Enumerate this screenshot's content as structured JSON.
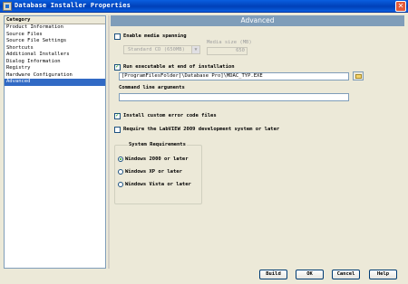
{
  "window": {
    "title": "Database Installer Properties",
    "close_glyph": "✕"
  },
  "category": {
    "header": "Category",
    "items": [
      "Product Information",
      "Source Files",
      "Source File Settings",
      "Shortcuts",
      "Additional Installers",
      "Dialog Information",
      "Registry",
      "Hardware Configuration",
      "Advanced"
    ],
    "selected": "Advanced"
  },
  "advanced": {
    "banner": "Advanced",
    "media_spanning": {
      "label": "Enable media spanning",
      "checked": false
    },
    "media_combo": {
      "value": "Standard CD (650MB)"
    },
    "media_size": {
      "label": "Media size (MB)",
      "value": "650"
    },
    "run_exe": {
      "label": "Run executable at end of installation",
      "checked": true
    },
    "exe_path": {
      "value": "[ProgramFilesFolder]\\Database Pro]\\MDAC_TYP.EXE"
    },
    "cmd_args": {
      "label": "Command line arguments",
      "value": ""
    },
    "custom_error": {
      "label": "Install custom error code files",
      "checked": true
    },
    "require_labview": {
      "label": "Require the LabVIEW 2009 development system or later",
      "checked": false
    },
    "system_requirements": {
      "title": "System Requirements",
      "options": [
        "Windows 2000 or later",
        "Windows XP or later",
        "Windows Vista or later"
      ],
      "selected": "Windows 2000 or later"
    }
  },
  "buttons": {
    "build": "Build",
    "ok": "OK",
    "cancel": "Cancel",
    "help": "Help"
  },
  "colors": {
    "title_bar": "#0a5fe0",
    "banner": "#7f9db9",
    "selection": "#316ac5",
    "dialog_bg": "#ece9d8"
  },
  "icons": {
    "window": "app-icon",
    "browse": "folder-icon",
    "close": "close-icon"
  }
}
